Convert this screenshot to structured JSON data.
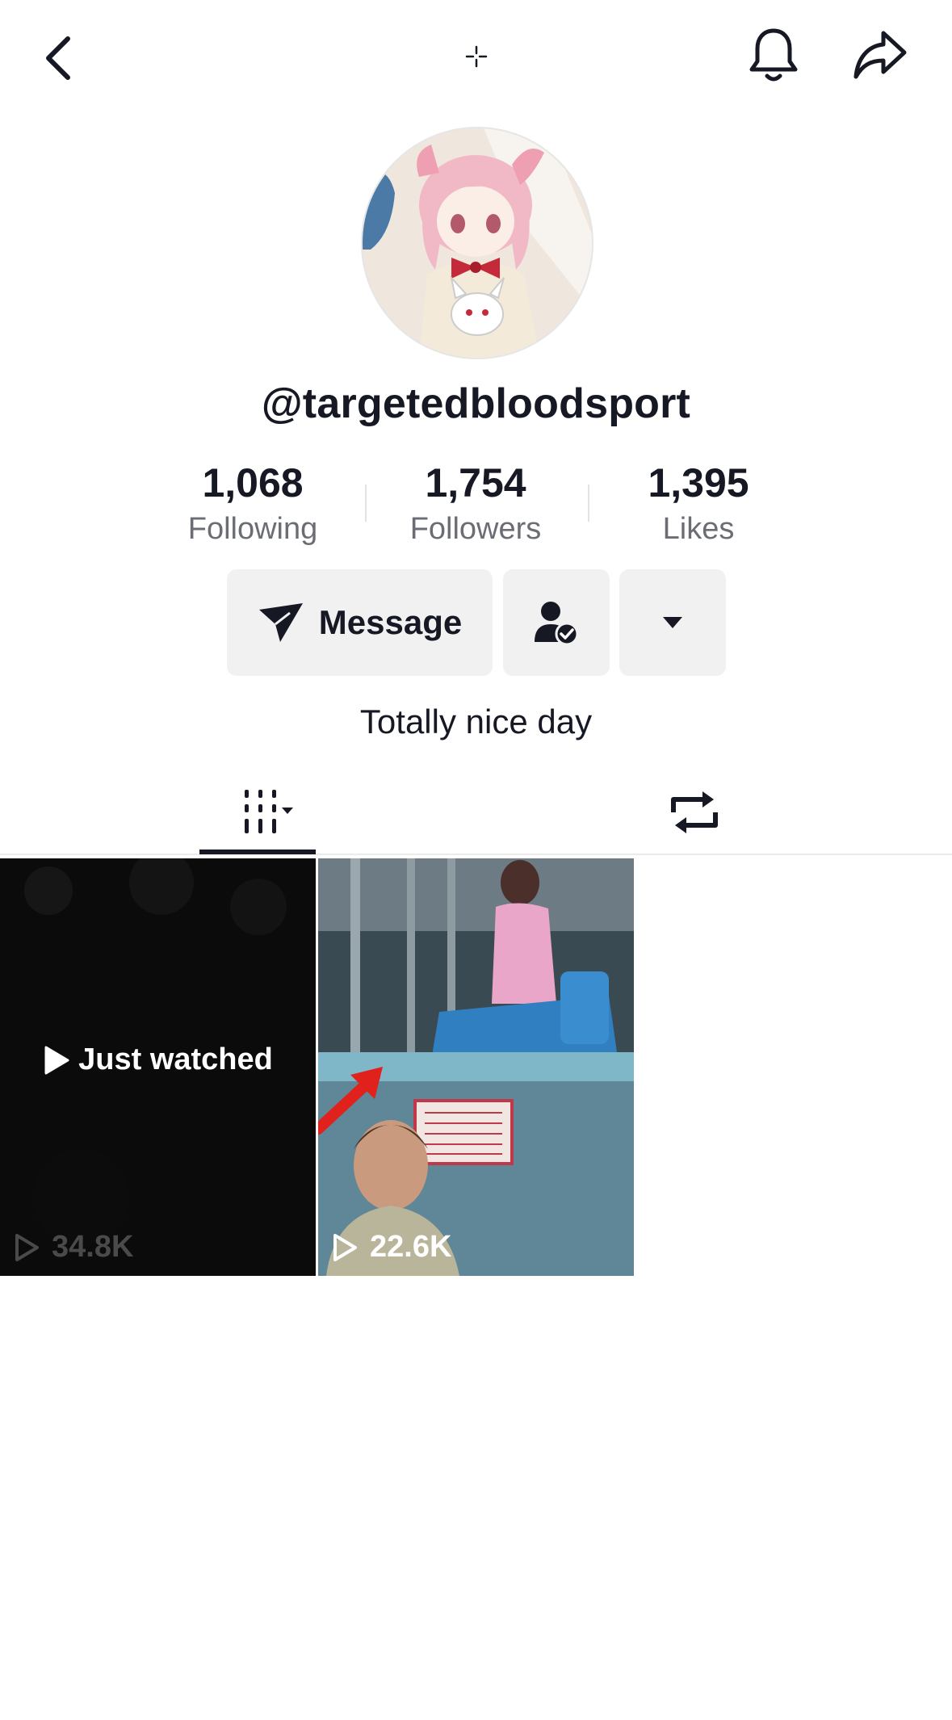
{
  "header": {
    "back_icon": "chevron-left-icon",
    "center_icon": "plus-crosshair-icon",
    "bell_icon": "bell-icon",
    "share_icon": "share-arrow-icon"
  },
  "profile": {
    "username": "@targetedbloodsport",
    "bio": "Totally nice day"
  },
  "stats": [
    {
      "value": "1,068",
      "label": "Following"
    },
    {
      "value": "1,754",
      "label": "Followers"
    },
    {
      "value": "1,395",
      "label": "Likes"
    }
  ],
  "actions": {
    "message_label": "Message",
    "message_icon": "send-icon",
    "friend_icon": "user-check-icon",
    "dropdown_icon": "caret-down-icon"
  },
  "tabs": [
    {
      "name": "videos",
      "icon": "grid-icon",
      "active": true
    },
    {
      "name": "reposts",
      "icon": "repost-icon",
      "active": false
    }
  ],
  "videos": [
    {
      "overlay": "Just watched",
      "views": "34.8K"
    },
    {
      "overlay": "",
      "views": "22.6K"
    }
  ],
  "colors": {
    "text": "#161823",
    "secondary": "#6b6d74",
    "button_bg": "#f1f1f2",
    "divider": "#ebebeb",
    "arrow_red": "#e0211c"
  }
}
